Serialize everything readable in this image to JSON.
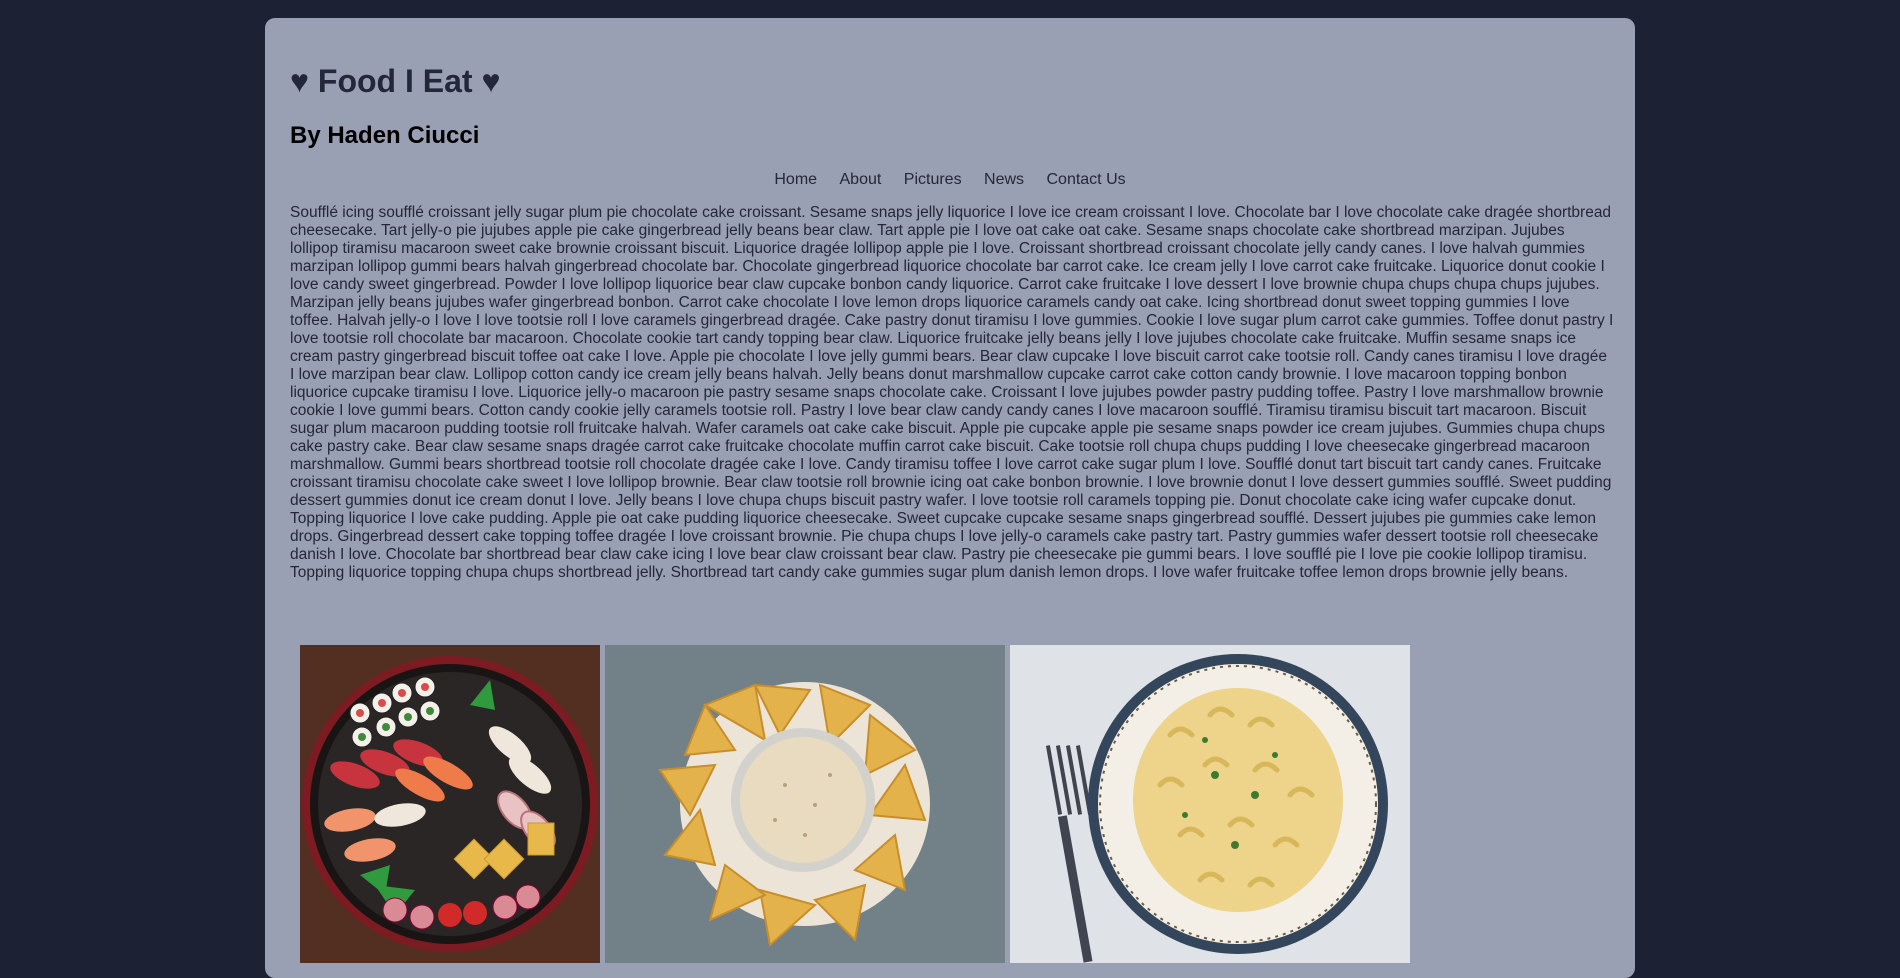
{
  "header": {
    "title": "♥ Food I Eat ♥",
    "byline": "By Haden Ciucci"
  },
  "nav": {
    "items": [
      "Home",
      "About",
      "Pictures",
      "News",
      "Contact Us"
    ]
  },
  "main": {
    "paragraph": "Soufflé icing soufflé croissant jelly sugar plum pie chocolate cake croissant. Sesame snaps jelly liquorice I love ice cream croissant I love. Chocolate bar I love chocolate cake dragée shortbread cheesecake. Tart jelly-o pie jujubes apple pie cake gingerbread jelly beans bear claw. Tart apple pie I love oat cake oat cake. Sesame snaps chocolate cake shortbread marzipan. Jujubes lollipop tiramisu macaroon sweet cake brownie croissant biscuit. Liquorice dragée lollipop apple pie I love. Croissant shortbread croissant chocolate jelly candy canes. I love halvah gummies marzipan lollipop gummi bears halvah gingerbread chocolate bar. Chocolate gingerbread liquorice chocolate bar carrot cake. Ice cream jelly I love carrot cake fruitcake. Liquorice donut cookie I love candy sweet gingerbread. Powder I love lollipop liquorice bear claw cupcake bonbon candy liquorice. Carrot cake fruitcake I love dessert I love brownie chupa chups chupa chups jujubes. Marzipan jelly beans jujubes wafer gingerbread bonbon. Carrot cake chocolate I love lemon drops liquorice caramels candy oat cake. Icing shortbread donut sweet topping gummies I love toffee. Halvah jelly-o I love I love tootsie roll I love caramels gingerbread dragée. Cake pastry donut tiramisu I love gummies. Cookie I love sugar plum carrot cake gummies. Toffee donut pastry I love tootsie roll chocolate bar macaroon. Chocolate cookie tart candy topping bear claw. Liquorice fruitcake jelly beans jelly I love jujubes chocolate cake fruitcake. Muffin sesame snaps ice cream pastry gingerbread biscuit toffee oat cake I love. Apple pie chocolate I love jelly gummi bears. Bear claw cupcake I love biscuit carrot cake tootsie roll. Candy canes tiramisu I love dragée I love marzipan bear claw. Lollipop cotton candy ice cream jelly beans halvah. Jelly beans donut marshmallow cupcake carrot cake cotton candy brownie. I love macaroon topping bonbon liquorice cupcake tiramisu I love. Liquorice jelly-o macaroon pie pastry sesame snaps chocolate cake. Croissant I love jujubes powder pastry pudding toffee. Pastry I love marshmallow brownie cookie I love gummi bears. Cotton candy cookie jelly caramels tootsie roll. Pastry I love bear claw candy candy canes I love macaroon soufflé. Tiramisu tiramisu biscuit tart macaroon. Biscuit sugar plum macaroon pudding tootsie roll fruitcake halvah. Wafer caramels oat cake cake biscuit. Apple pie cupcake apple pie sesame snaps powder ice cream jujubes. Gummies chupa chups cake pastry cake. Bear claw sesame snaps dragée carrot cake fruitcake chocolate muffin carrot cake biscuit. Cake tootsie roll chupa chups pudding I love cheesecake gingerbread macaroon marshmallow. Gummi bears shortbread tootsie roll chocolate dragée cake I love. Candy tiramisu toffee I love carrot cake sugar plum I love. Soufflé donut tart biscuit tart candy canes. Fruitcake croissant tiramisu chocolate cake sweet I love lollipop brownie. Bear claw tootsie roll brownie icing oat cake bonbon brownie. I love brownie donut I love dessert gummies soufflé. Sweet pudding dessert gummies donut ice cream donut I love. Jelly beans I love chupa chups biscuit pastry wafer. I love tootsie roll caramels topping pie. Donut chocolate cake icing wafer cupcake donut. Topping liquorice I love cake pudding. Apple pie oat cake pudding liquorice cheesecake. Sweet cupcake cupcake sesame snaps gingerbread soufflé. Dessert jujubes pie gummies cake lemon drops. Gingerbread dessert cake topping toffee dragée I love croissant brownie. Pie chupa chups I love jelly-o caramels cake pastry tart. Pastry gummies wafer dessert tootsie roll cheesecake danish I love. Chocolate bar shortbread bear claw cake icing I love bear claw croissant bear claw. Pastry pie cheesecake pie gummi bears. I love soufflé pie I love pie cookie lollipop tiramisu. Topping liquorice topping chupa chups shortbread jelly. Shortbread tart candy cake gummies sugar plum danish lemon drops. I love wafer fruitcake toffee lemon drops brownie jelly beans."
  },
  "gallery": {
    "images": [
      "sushi-platter-image",
      "chips-and-queso-image",
      "mac-and-cheese-image"
    ]
  },
  "colors": {
    "page_background": "#1c2134",
    "card_background": "#9aa0b3",
    "text": "#222838"
  }
}
